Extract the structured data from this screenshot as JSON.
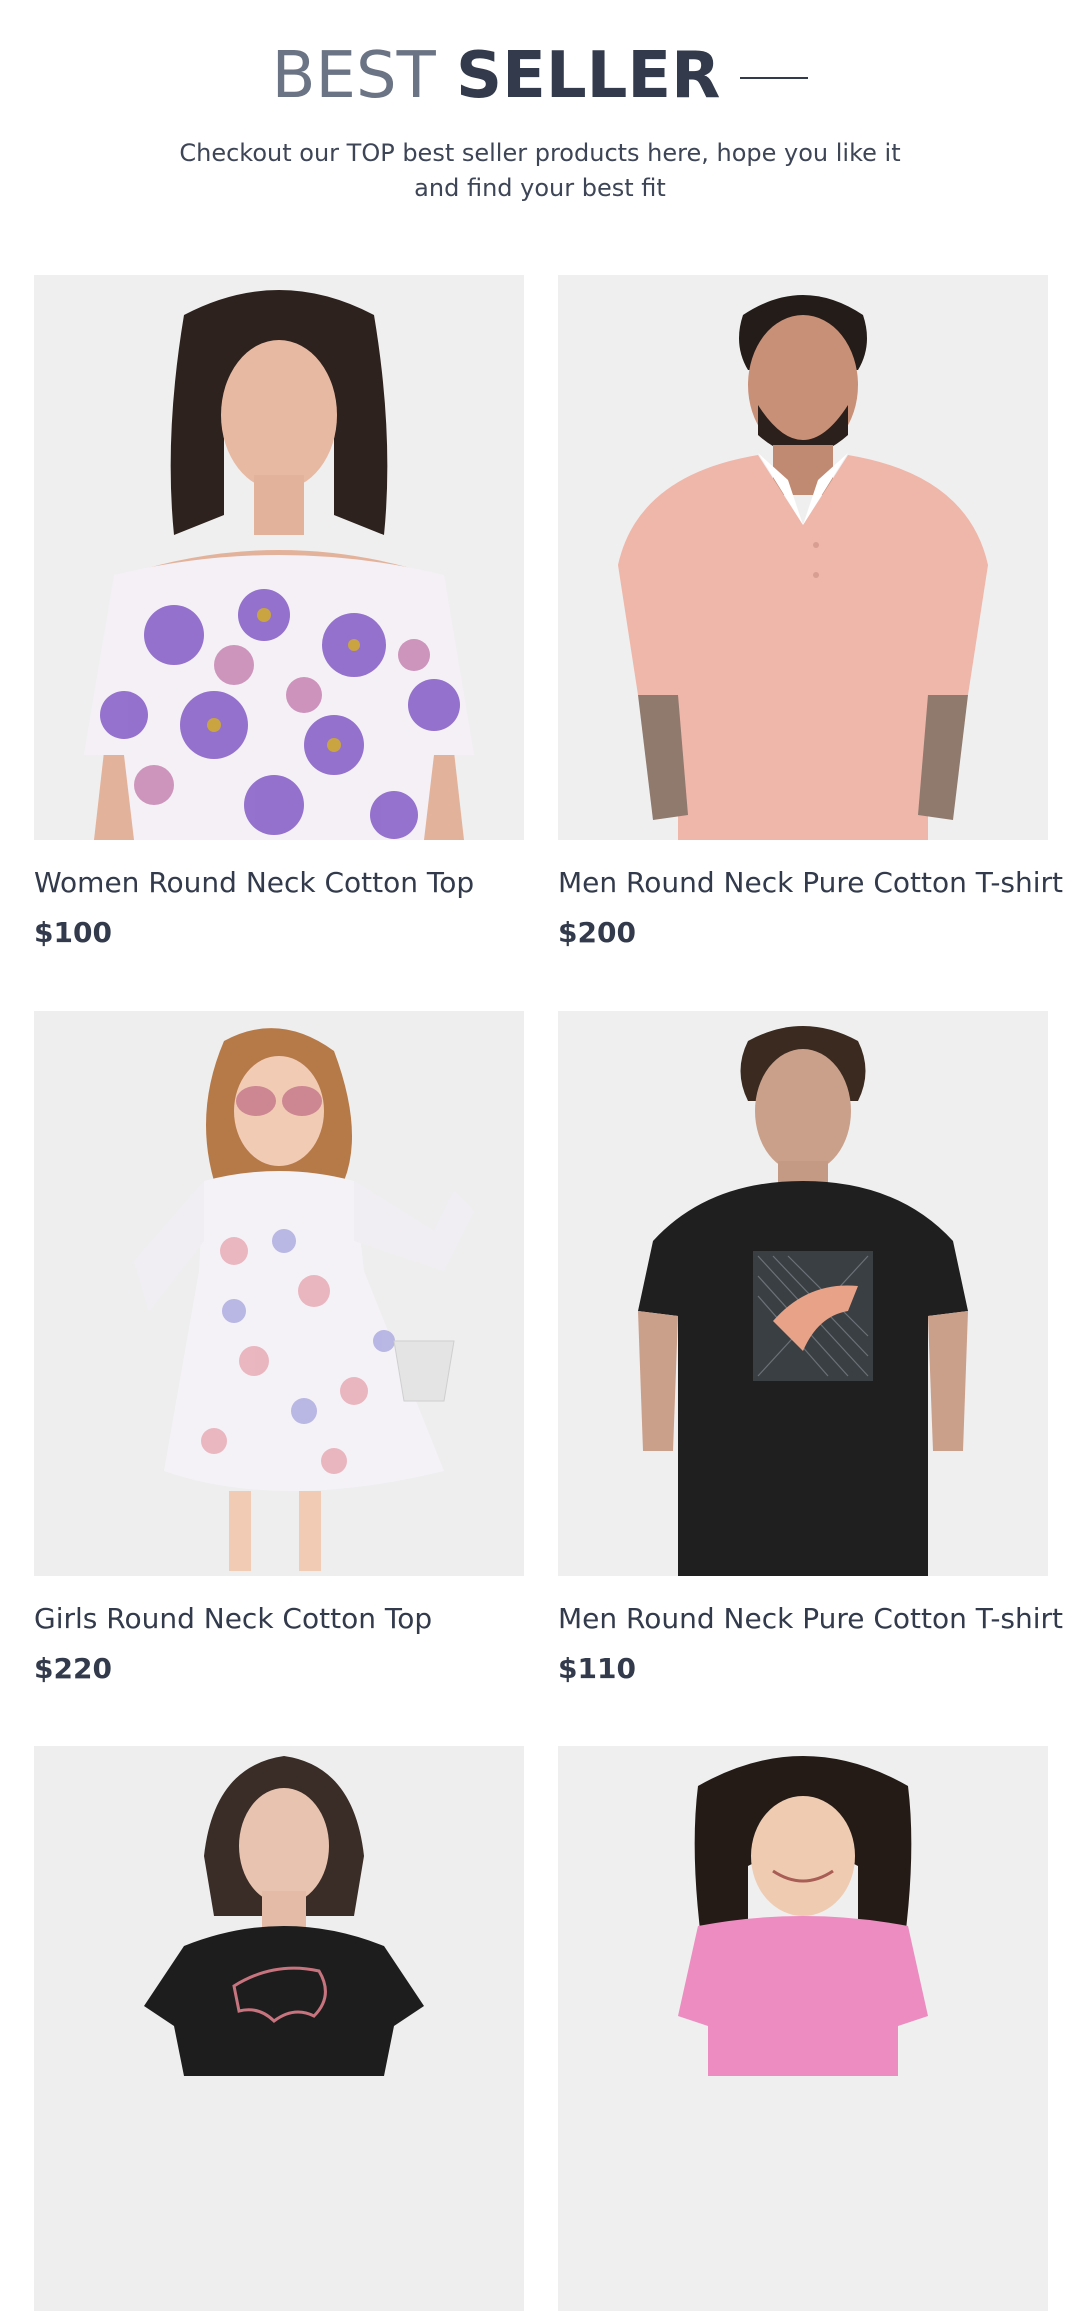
{
  "header": {
    "title_light": "BEST ",
    "title_bold": "SELLER",
    "subtitle": "Checkout our TOP best seller products here, hope you like it and find your best fit"
  },
  "products": [
    {
      "name": "Women Round Neck Cotton Top",
      "price": "$100",
      "image": "woman-floral-offshoulder-top-photo"
    },
    {
      "name": "Men Round Neck Pure Cotton T-shirt",
      "price": "$200",
      "image": "man-pink-polo-shirt-photo"
    },
    {
      "name": "Girls Round Neck Cotton Top",
      "price": "$220",
      "image": "girl-floral-dress-photo"
    },
    {
      "name": "Men Round Neck Pure Cotton T-shirt",
      "price": "$110",
      "image": "man-black-puma-tshirt-photo"
    },
    {
      "name": "",
      "price": "",
      "image": "woman-black-puma-tshirt-photo"
    },
    {
      "name": "",
      "price": "",
      "image": "girl-pink-top-photo"
    }
  ],
  "colors": {
    "text": "#323a4b",
    "title_light": "#6b7484",
    "photo_bg": "#efefef"
  }
}
